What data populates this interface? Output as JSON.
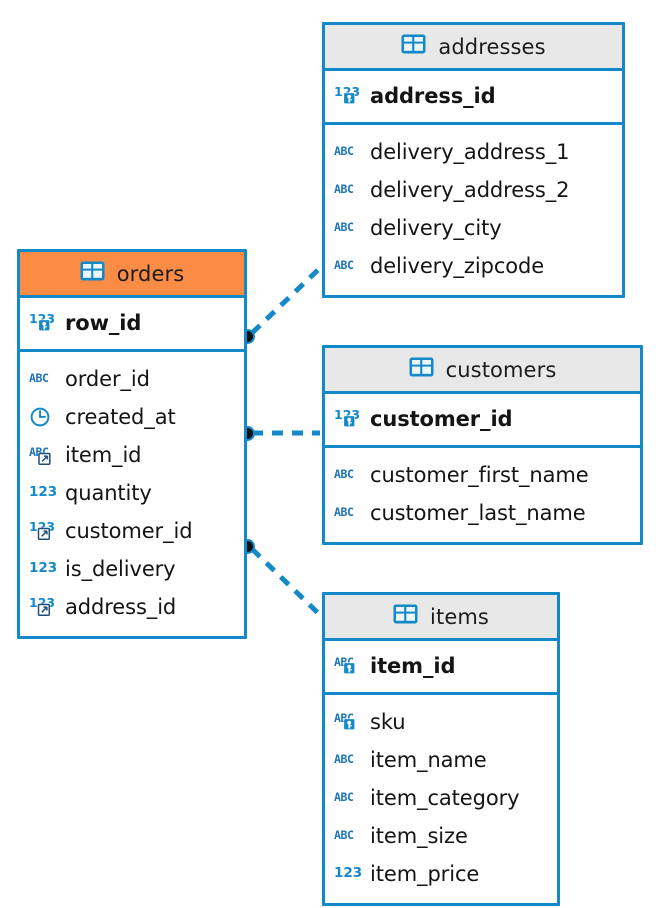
{
  "diagram": {
    "kind": "entity-relationship-diagram",
    "colors": {
      "table_border": "#1489ca",
      "header_default": "#e8e8e8",
      "header_highlight": "#fa8c46",
      "icon_blue": "#1489ca",
      "link_line": "#1489ca",
      "dot": "#111111",
      "text": "#141414",
      "background": "#ffffff"
    },
    "tables": [
      {
        "id": "addresses",
        "name": "addresses",
        "highlighted": false,
        "primary_key": {
          "name": "address_id",
          "type": "number",
          "key": "primary"
        },
        "columns": [
          {
            "name": "delivery_address_1",
            "type": "text"
          },
          {
            "name": "delivery_address_2",
            "type": "text"
          },
          {
            "name": "delivery_city",
            "type": "text"
          },
          {
            "name": "delivery_zipcode",
            "type": "text"
          }
        ]
      },
      {
        "id": "orders",
        "name": "orders",
        "highlighted": true,
        "primary_key": {
          "name": "row_id",
          "type": "number",
          "key": "primary"
        },
        "columns": [
          {
            "name": "order_id",
            "type": "text"
          },
          {
            "name": "created_at",
            "type": "datetime"
          },
          {
            "name": "item_id",
            "type": "text",
            "key": "foreign"
          },
          {
            "name": "quantity",
            "type": "number"
          },
          {
            "name": "customer_id",
            "type": "number",
            "key": "foreign"
          },
          {
            "name": "is_delivery",
            "type": "number"
          },
          {
            "name": "address_id",
            "type": "number",
            "key": "foreign"
          }
        ]
      },
      {
        "id": "customers",
        "name": "customers",
        "highlighted": false,
        "primary_key": {
          "name": "customer_id",
          "type": "number",
          "key": "primary"
        },
        "columns": [
          {
            "name": "customer_first_name",
            "type": "text"
          },
          {
            "name": "customer_last_name",
            "type": "text"
          }
        ]
      },
      {
        "id": "items",
        "name": "items",
        "highlighted": false,
        "primary_key": {
          "name": "item_id",
          "type": "text",
          "key": "primary"
        },
        "columns": [
          {
            "name": "sku",
            "type": "text",
            "key": "unique"
          },
          {
            "name": "item_name",
            "type": "text"
          },
          {
            "name": "item_category",
            "type": "text"
          },
          {
            "name": "item_size",
            "type": "text"
          },
          {
            "name": "item_price",
            "type": "number"
          }
        ]
      }
    ],
    "relationships": [
      {
        "from": "orders.address_id",
        "to": "addresses.address_id",
        "style": "dashed"
      },
      {
        "from": "orders.customer_id",
        "to": "customers.customer_id",
        "style": "dashed"
      },
      {
        "from": "orders.item_id",
        "to": "items.item_id",
        "style": "dashed"
      }
    ],
    "icon_labels": {
      "table": "table-grid-icon",
      "text": "abc-text-type-icon",
      "number": "123-number-type-icon",
      "datetime": "clock-datetime-type-icon",
      "primary_key": "key-icon",
      "foreign_key": "foreign-key-arrow-icon",
      "unique_key": "key-icon"
    }
  }
}
